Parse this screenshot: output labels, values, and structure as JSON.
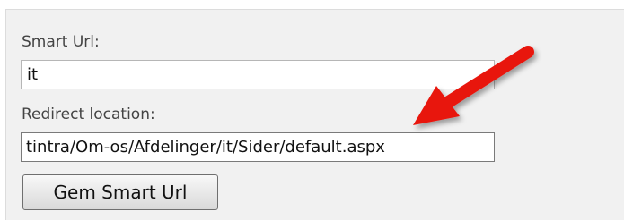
{
  "form": {
    "smart_url_label": "Smart Url:",
    "smart_url_value": "it",
    "redirect_label": "Redirect location:",
    "redirect_value": "tintra/Om-os/Afdelinger/it/Sider/default.aspx",
    "submit_label": "Gem Smart Url"
  },
  "annotation": {
    "arrow_color": "#e8150f",
    "arrow_icon": "red-arrow-icon"
  }
}
